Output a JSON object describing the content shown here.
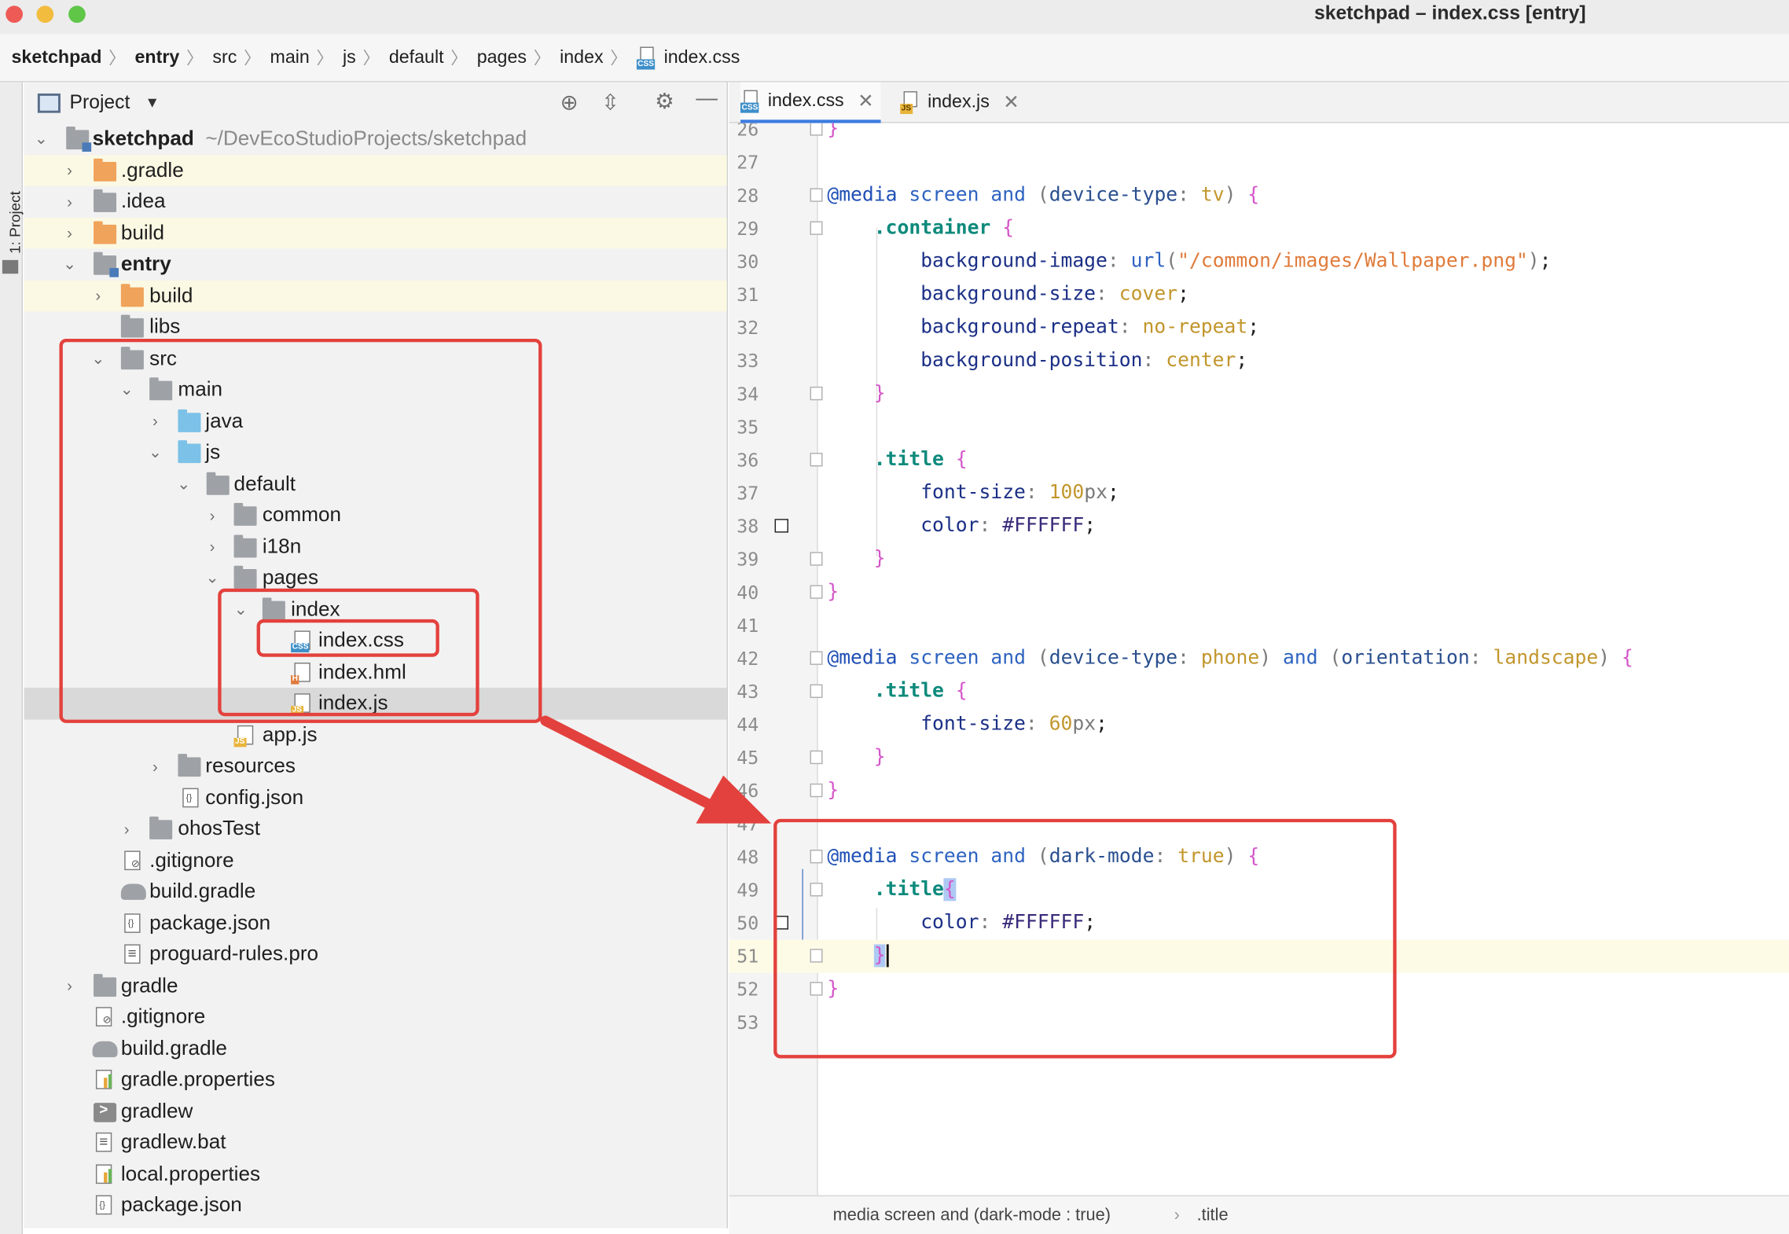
{
  "window": {
    "title": "sketchpad – index.css [entry]"
  },
  "breadcrumb": [
    "sketchpad",
    "entry",
    "src",
    "main",
    "js",
    "default",
    "pages",
    "index",
    "index.css"
  ],
  "toolstrip": {
    "label": "1: Project"
  },
  "project_panel": {
    "title": "Project",
    "root_name": "sketchpad",
    "root_path": "~/DevEcoStudioProjects/sketchpad",
    "items": [
      {
        "label": ".gradle"
      },
      {
        "label": ".idea"
      },
      {
        "label": "build"
      },
      {
        "label": "entry"
      },
      {
        "label": "build"
      },
      {
        "label": "libs"
      },
      {
        "label": "src"
      },
      {
        "label": "main"
      },
      {
        "label": "java"
      },
      {
        "label": "js"
      },
      {
        "label": "default"
      },
      {
        "label": "common"
      },
      {
        "label": "i18n"
      },
      {
        "label": "pages"
      },
      {
        "label": "index"
      },
      {
        "label": "index.css"
      },
      {
        "label": "index.hml"
      },
      {
        "label": "index.js"
      },
      {
        "label": "app.js"
      },
      {
        "label": "resources"
      },
      {
        "label": "config.json"
      },
      {
        "label": "ohosTest"
      },
      {
        "label": ".gitignore"
      },
      {
        "label": "build.gradle"
      },
      {
        "label": "package.json"
      },
      {
        "label": "proguard-rules.pro"
      },
      {
        "label": "gradle"
      },
      {
        "label": ".gitignore"
      },
      {
        "label": "build.gradle"
      },
      {
        "label": "gradle.properties"
      },
      {
        "label": "gradlew"
      },
      {
        "label": "gradlew.bat"
      },
      {
        "label": "local.properties"
      },
      {
        "label": "package.json"
      }
    ]
  },
  "tabs": [
    {
      "label": "index.css",
      "icon": "css-file-icon",
      "active": true
    },
    {
      "label": "index.js",
      "icon": "js-file-icon",
      "active": false
    }
  ],
  "editor": {
    "current_line": 51,
    "lines": [
      {
        "n": "26",
        "text": "}"
      },
      {
        "n": "27",
        "text": ""
      },
      {
        "n": "28",
        "text": "@media screen and (device-type: tv) {"
      },
      {
        "n": "29",
        "text": "    .container {"
      },
      {
        "n": "30",
        "text": "        background-image: url(\"/common/images/Wallpaper.png\");"
      },
      {
        "n": "31",
        "text": "        background-size: cover;"
      },
      {
        "n": "32",
        "text": "        background-repeat: no-repeat;"
      },
      {
        "n": "33",
        "text": "        background-position: center;"
      },
      {
        "n": "34",
        "text": "    }"
      },
      {
        "n": "35",
        "text": ""
      },
      {
        "n": "36",
        "text": "    .title {"
      },
      {
        "n": "37",
        "text": "        font-size: 100px;"
      },
      {
        "n": "38",
        "text": "        color: #FFFFFF;"
      },
      {
        "n": "39",
        "text": "    }"
      },
      {
        "n": "40",
        "text": "}"
      },
      {
        "n": "41",
        "text": ""
      },
      {
        "n": "42",
        "text": "@media screen and (device-type: phone) and (orientation: landscape) {"
      },
      {
        "n": "43",
        "text": "    .title {"
      },
      {
        "n": "44",
        "text": "        font-size: 60px;"
      },
      {
        "n": "45",
        "text": "    }"
      },
      {
        "n": "46",
        "text": "}"
      },
      {
        "n": "47",
        "text": ""
      },
      {
        "n": "48",
        "text": "@media screen and (dark-mode: true) {"
      },
      {
        "n": "49",
        "text": "    .title{"
      },
      {
        "n": "50",
        "text": "        color: #FFFFFF;"
      },
      {
        "n": "51",
        "text": "    }"
      },
      {
        "n": "52",
        "text": "}"
      },
      {
        "n": "53",
        "text": ""
      }
    ]
  },
  "status": {
    "scope": "media screen and (dark-mode : true)",
    "selector": ".title"
  },
  "colors": {
    "annotation_red": "#e3413d",
    "accent_blue": "#3c7be0",
    "current_line": "#fdfbe6"
  }
}
